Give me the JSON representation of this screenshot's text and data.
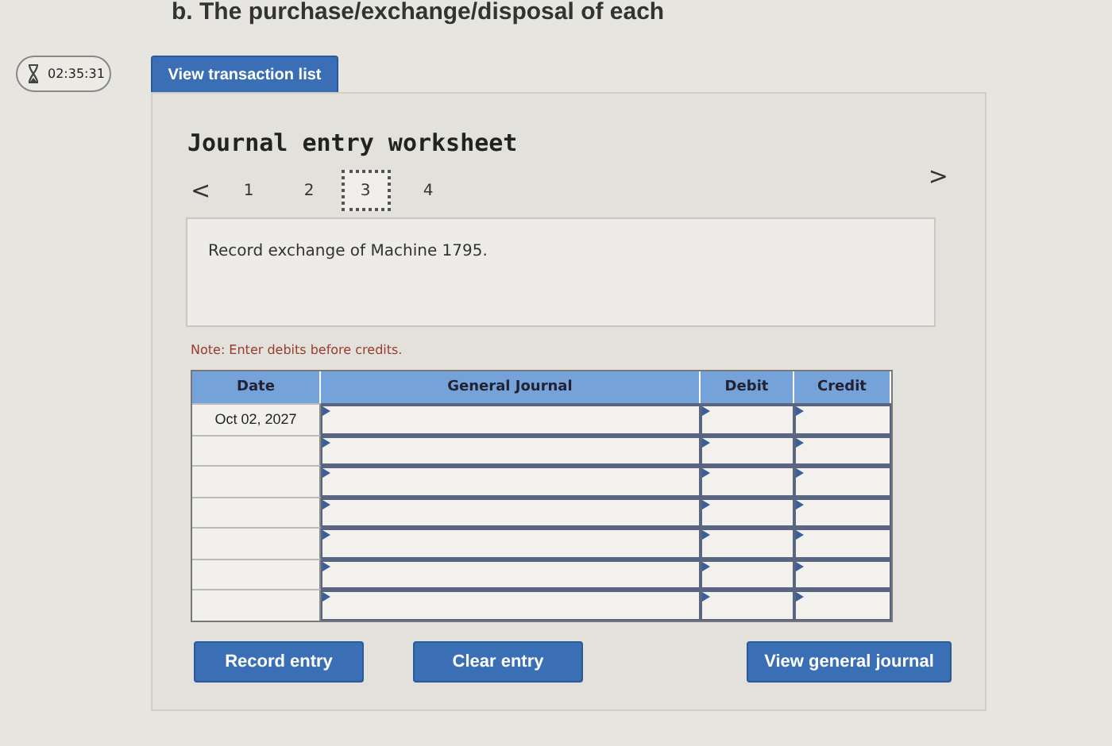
{
  "question_text": "b. The purchase/exchange/disposal of each",
  "timer": "02:35:31",
  "top_button": "View transaction list",
  "worksheet": {
    "title": "Journal entry worksheet",
    "pager": {
      "prev": "<",
      "next": ">",
      "pages": [
        {
          "label": "1",
          "selected": false
        },
        {
          "label": "2",
          "selected": false
        },
        {
          "label": "3",
          "selected": true
        },
        {
          "label": "4",
          "selected": false
        }
      ]
    },
    "description": "Record exchange of Machine 1795.",
    "note": "Note: Enter debits before credits.",
    "table": {
      "columns": [
        "Date",
        "General Journal",
        "Debit",
        "Credit"
      ],
      "rows": [
        {
          "date": "Oct 02, 2027"
        },
        {},
        {},
        {},
        {},
        {},
        {}
      ]
    },
    "buttons": [
      "Record entry",
      "Clear entry",
      "View general journal"
    ]
  }
}
